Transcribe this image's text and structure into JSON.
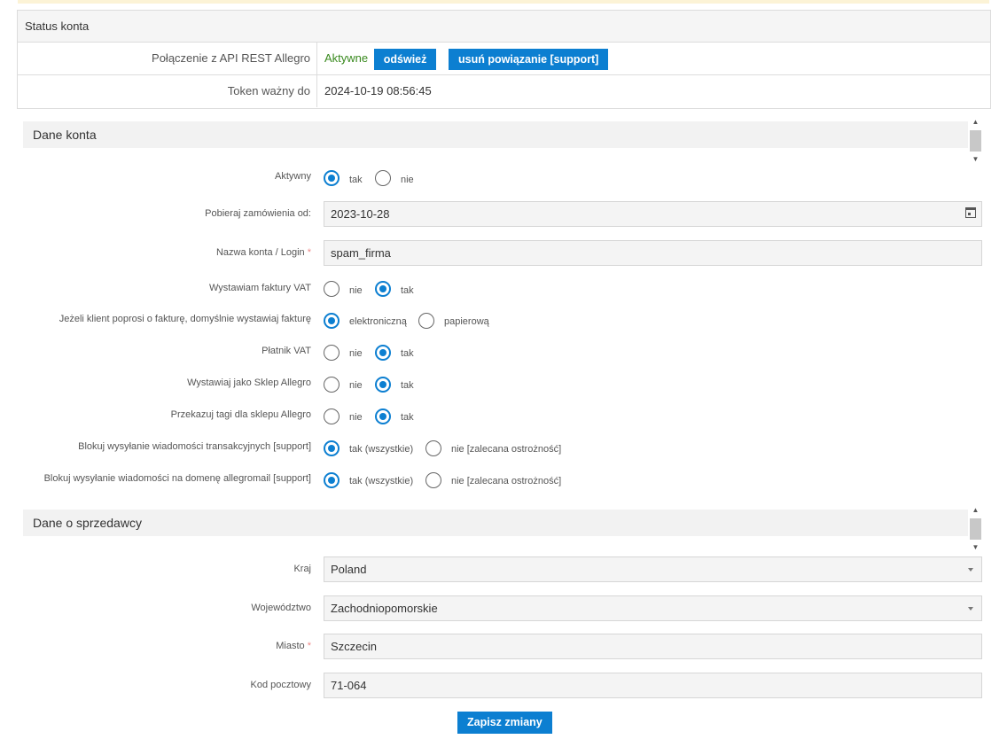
{
  "status": {
    "title": "Status konta",
    "api_label": "Połączenie z API REST Allegro",
    "api_status": "Aktywne",
    "refresh_btn": "odśwież",
    "unlink_btn": "usuń powiązanie [support]",
    "token_label": "Token ważny do",
    "token_value": "2024-10-19 08:56:45"
  },
  "account": {
    "title": "Dane konta",
    "active_label": "Aktywny",
    "yes": "tak",
    "no": "nie",
    "fetch_label": "Pobieraj zamówienia od:",
    "fetch_value": "2023-10-28",
    "login_label": "Nazwa konta / Login",
    "required_mark": "*",
    "login_value": "spam_firma",
    "vat_invoice_label": "Wystawiam faktury VAT",
    "invoice_default_label": "Jeżeli klient poprosi o fakturę, domyślnie wystawiaj fakturę",
    "electronic": "elektroniczną",
    "paper": "papierową",
    "vat_payer_label": "Płatnik VAT",
    "shop_label": "Wystawiaj jako Sklep Allegro",
    "tags_label": "Przekazuj tagi dla sklepu Allegro",
    "block_trans_label": "Blokuj wysyłanie wiadomości transakcyjnych [support]",
    "block_domain_label": "Blokuj wysyłanie wiadomości na domenę allegromail [support]",
    "yes_all": "tak (wszystkie)",
    "no_careful": "nie [zalecana ostrożność]"
  },
  "seller": {
    "title": "Dane o sprzedawcy",
    "country_label": "Kraj",
    "country_value": "Poland",
    "region_label": "Województwo",
    "region_value": "Zachodniopomorskie",
    "city_label": "Miasto",
    "city_value": "Szczecin",
    "zip_label": "Kod pocztowy",
    "zip_value": "71-064"
  },
  "save_btn": "Zapisz zmiany",
  "colors": {
    "accent": "#0c7fd1",
    "active_green": "#3a8a1f"
  }
}
